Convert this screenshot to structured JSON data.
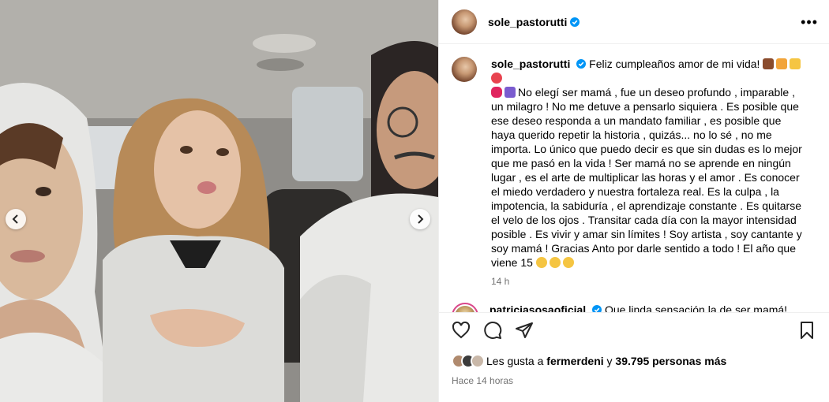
{
  "post": {
    "username": "sole_pastorutti",
    "more_icon": "more-horizontal-icon"
  },
  "caption": {
    "username": "sole_pastorutti",
    "lines_text": "Feliz cumpleaños amor de mi vida!",
    "body_text": "No elegí ser mamá , fue un deseo profundo , imparable , un milagro ! No me detuve a pensarlo siquiera . Es posible que ese deseo responda a un mandato familiar , es posible que haya querido repetir la historia , quizás... no lo sé , no me importa. Lo único que puedo decir es que sin dudas es lo mejor que me pasó en la vida ! Ser mamá no se aprende en ningún lugar , es el arte de multiplicar las horas y el amor . Es conocer el miedo verdadero y nuestra fortaleza real. Es la culpa , la impotencia, la sabiduría , el aprendizaje constante . Es quitarse el velo de los ojos . Transitar cada día con la mayor intensidad posible . Es vivir y amar sin límites ! Soy artista , soy cantante y soy mamá ! Gracias Anto por darle sentido a todo ! El año que viene 15",
    "time": "14 h"
  },
  "comment": {
    "username": "patriciasosaoficial",
    "text": "Que linda sensación la de ser mamá! Feliz cumple Anto! Disfruten la vida"
  },
  "likes": {
    "prefix": "Les gusta a",
    "user": "fermerdeni",
    "middle": "y",
    "count": "39.795 personas más"
  },
  "timestamp": "Hace 14 horas",
  "colors": {
    "verified": "#0095f6",
    "heart": "#ed4956",
    "muted": "#737373"
  }
}
